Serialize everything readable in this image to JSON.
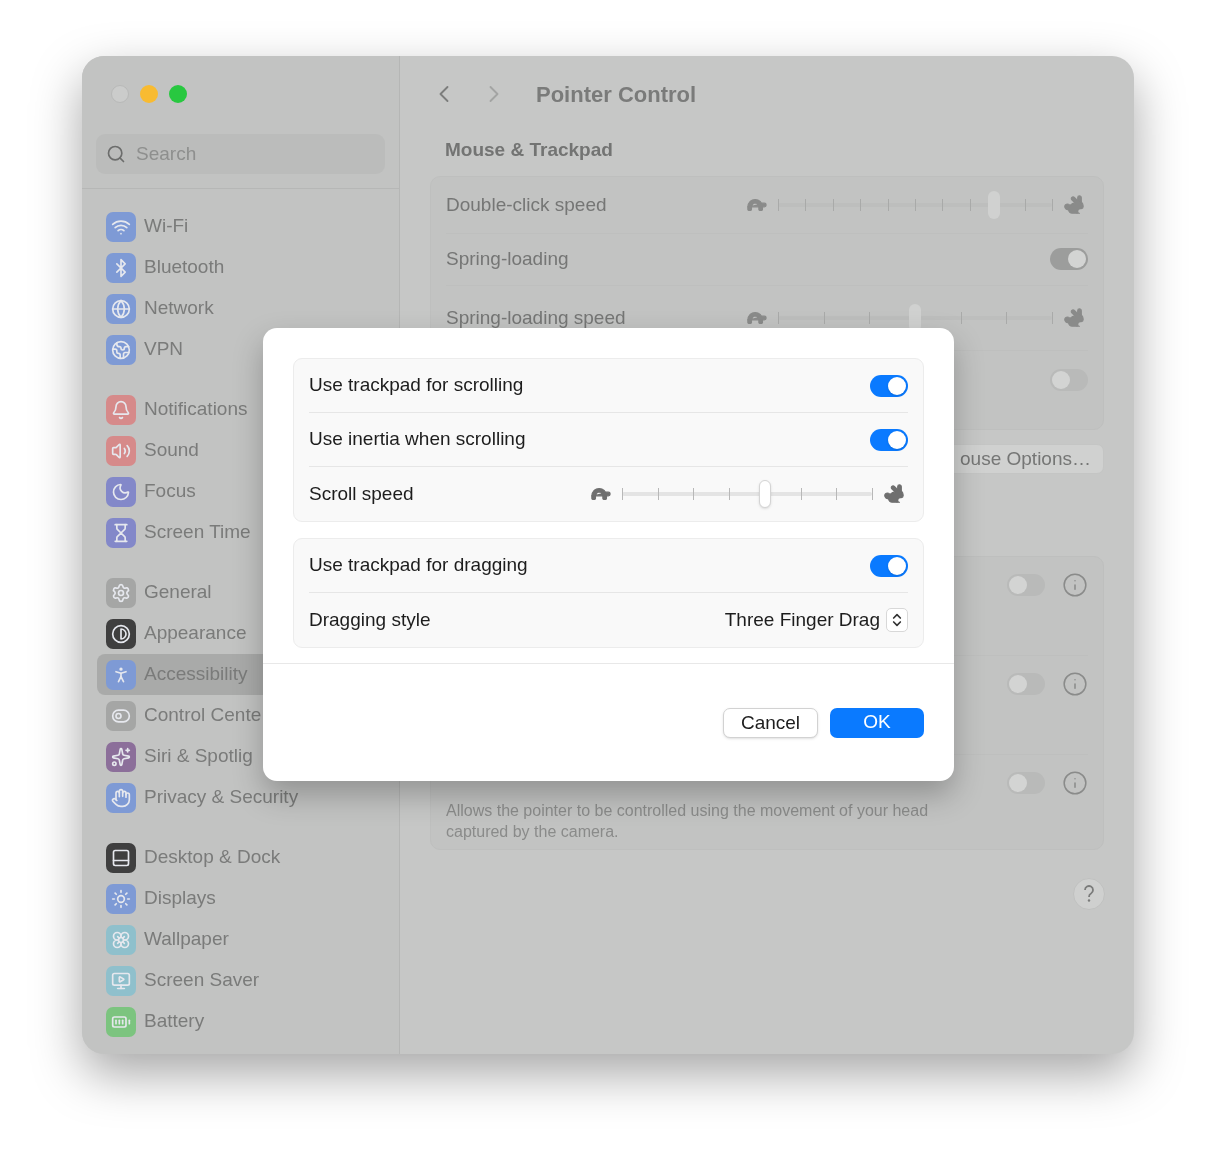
{
  "sidebar": {
    "search": {
      "placeholder": "Search"
    },
    "groups": [
      {
        "items": [
          {
            "label": "Wi-Fi",
            "selected": false
          },
          {
            "label": "Bluetooth",
            "selected": false
          },
          {
            "label": "Network",
            "selected": false
          },
          {
            "label": "VPN",
            "selected": false
          }
        ]
      },
      {
        "items": [
          {
            "label": "Notifications",
            "selected": false
          },
          {
            "label": "Sound",
            "selected": false
          },
          {
            "label": "Focus",
            "selected": false
          },
          {
            "label": "Screen Time",
            "selected": false
          }
        ]
      },
      {
        "items": [
          {
            "label": "General",
            "selected": false
          },
          {
            "label": "Appearance",
            "selected": false
          },
          {
            "label": "Accessibility",
            "selected": true
          },
          {
            "label": "Control Cente",
            "selected": false
          },
          {
            "label": "Siri & Spotlig",
            "selected": false
          },
          {
            "label": "Privacy & Security",
            "selected": false
          }
        ]
      },
      {
        "items": [
          {
            "label": "Desktop & Dock",
            "selected": false
          },
          {
            "label": "Displays",
            "selected": false
          },
          {
            "label": "Wallpaper",
            "selected": false
          },
          {
            "label": "Screen Saver",
            "selected": false
          },
          {
            "label": "Battery",
            "selected": false
          }
        ]
      }
    ]
  },
  "header": {
    "title": "Pointer Control"
  },
  "section_title": "Mouse & Trackpad",
  "mouse_trackpad_rows": [
    {
      "kind": "slider",
      "label": "Double-click speed",
      "level": 0.79
    },
    {
      "kind": "toggle",
      "label": "Spring-loading",
      "on": true
    },
    {
      "kind": "slider",
      "label": "Spring-loading speed",
      "level": 0.5
    },
    {
      "kind": "toggle",
      "on": false
    }
  ],
  "mouse_options_button": "ouse Options…",
  "pointer_rows": [
    {
      "on": false
    },
    {
      "on": false
    },
    {
      "on": false,
      "description": "Allows the pointer to be controlled using the movement of your head captured by the camera."
    }
  ],
  "dialog": {
    "groups": [
      {
        "rows": [
          {
            "kind": "toggle",
            "label": "Use trackpad for scrolling",
            "on": true
          },
          {
            "kind": "toggle",
            "label": "Use inertia when scrolling",
            "on": true
          },
          {
            "kind": "slider",
            "label": "Scroll speed",
            "level": 0.57
          }
        ]
      },
      {
        "rows": [
          {
            "kind": "toggle",
            "label": "Use trackpad for dragging",
            "on": true
          },
          {
            "kind": "popup",
            "label": "Dragging style",
            "value": "Three Finger Drag"
          }
        ]
      }
    ],
    "buttons": [
      {
        "kind": "secondary",
        "label": "Cancel"
      },
      {
        "kind": "primary",
        "label": "OK"
      }
    ]
  }
}
